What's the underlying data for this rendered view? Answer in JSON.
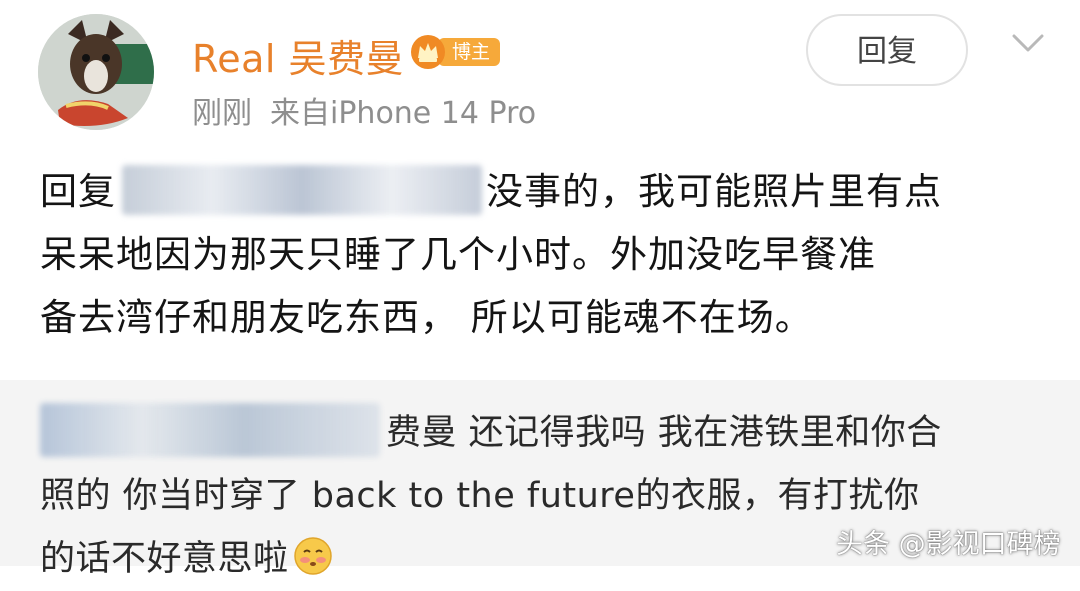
{
  "user": {
    "name": "Real 吴费曼",
    "badge_label": "博主",
    "time": "刚刚",
    "source": "来自iPhone 14 Pro"
  },
  "actions": {
    "reply_label": "回复",
    "more_icon": "chevron-down-icon"
  },
  "post": {
    "reply_prefix": "回复",
    "line1_rest": "没事的，我可能照片里有点",
    "line2": "呆呆地因为那天只睡了几个小时。外加没吃早餐准",
    "line3": "备去湾仔和朋友吃东西， 所以可能魂不在场。"
  },
  "quoted": {
    "line1_rest": "费曼 还记得我吗 我在港铁里和你合",
    "line2": "照的 你当时穿了 back to the future的衣服，有打扰你",
    "line3": "的话不好意思啦"
  },
  "watermark": "头条 @影视口碑榜",
  "colors": {
    "username": "#e8812b",
    "badge": "#f6a93a",
    "meta": "#8e8e8e",
    "quote_bg": "#f4f4f4"
  }
}
